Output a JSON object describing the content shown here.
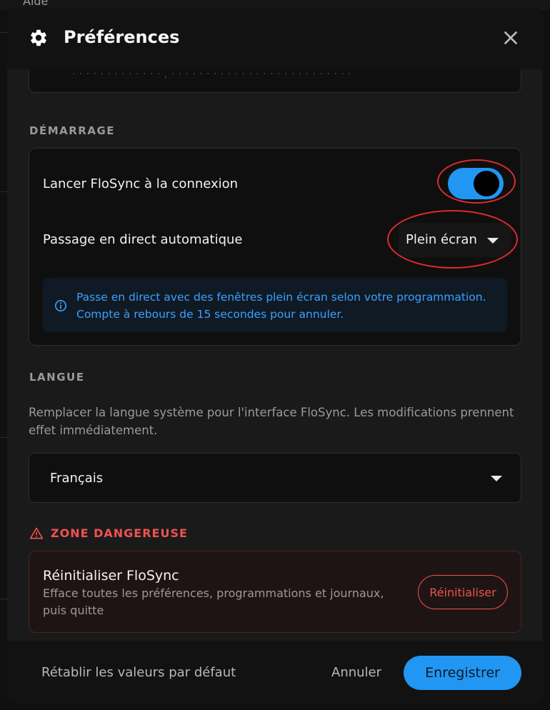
{
  "background": {
    "menu_label": "Aide"
  },
  "dialog": {
    "title": "Préférences",
    "icons": {
      "title_icon": "gear-icon",
      "close_icon": "close-icon"
    }
  },
  "startup": {
    "section_label": "DÉMARRAGE",
    "launch_label": "Lancer FloSync à la connexion",
    "launch_enabled": true,
    "auto_live_label": "Passage en direct automatique",
    "auto_live_value": "Plein écran",
    "info_text": "Passe en direct avec des fenêtres plein écran selon votre programmation. Compte à rebours de 15 secondes pour annuler."
  },
  "language": {
    "section_label": "LANGUE",
    "description": "Remplacer la langue système pour l'interface FloSync. Les modifications prennent effet immédiatement.",
    "selected": "Français"
  },
  "danger": {
    "section_label": "ZONE DANGEREUSE",
    "title": "Réinitialiser FloSync",
    "description": "Efface toutes les préférences, programmations et journaux, puis quitte",
    "button_label": "Réinitialiser"
  },
  "footer": {
    "defaults_label": "Rétablir les valeurs par défaut",
    "cancel_label": "Annuler",
    "save_label": "Enregistrer"
  },
  "colors": {
    "accent": "#2196f3",
    "danger": "#f05252",
    "annotation": "#e02a2a"
  }
}
